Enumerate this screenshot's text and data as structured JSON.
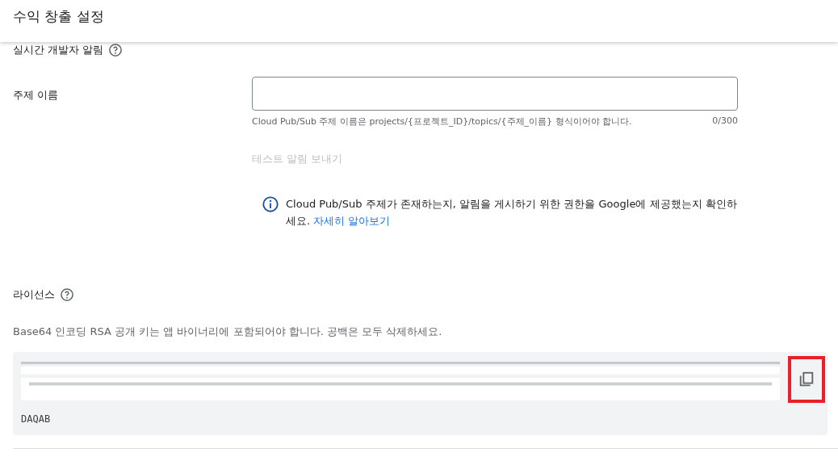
{
  "header": {
    "title": "수익 창출 설정"
  },
  "realtime_notifications": {
    "title": "실시간 개발자 알림",
    "topic_name": {
      "label": "주제 이름",
      "helper": "Cloud Pub/Sub 주제 이름은 projects/{프로젝트_ID}/topics/{주제_이름} 형식이어야 합니다.",
      "counter": "0/300"
    },
    "test_button": {
      "label": "테스트 알림 보내기",
      "disabled": true
    },
    "info": {
      "text": "Cloud Pub/Sub 주제가 존재하는지, 알림을 게시하기 위한 권한을 Google에 제공했는지 확인하세요.",
      "link": "자세히 알아보기"
    }
  },
  "license": {
    "title": "라이선스",
    "description": "Base64 인코딩 RSA 공개 키는 앱 바이너리에 포함되어야 합니다. 공백은 모두 삭제하세요.",
    "key_visible_text": "DAQAB",
    "copy_highlighted": true
  }
}
